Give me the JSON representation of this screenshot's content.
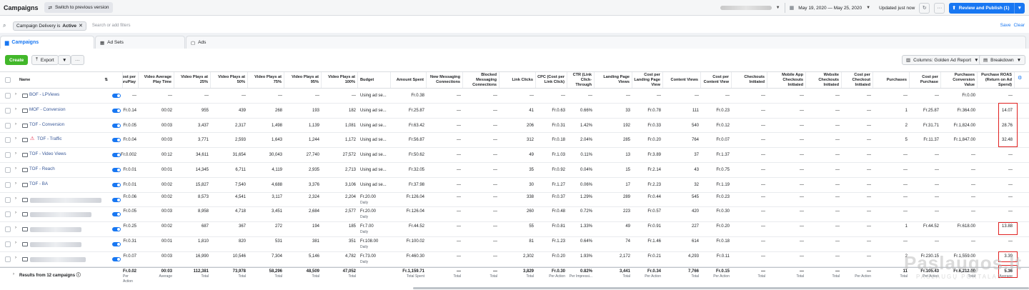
{
  "topbar": {
    "title": "Campaigns",
    "switch_label": "Switch to previous version",
    "date_range": "May 19, 2020 — May 25, 2020",
    "updated": "Updated just now",
    "publish_label": "Review and Publish (1)",
    "more": "···"
  },
  "filter": {
    "chip_prefix": "Campaign Delivery is ",
    "chip_value": "Active",
    "placeholder": "Search or add filters",
    "save": "Save",
    "clear": "Clear"
  },
  "tabs": {
    "campaigns": "Campaigns",
    "ad_sets": "Ad Sets",
    "ads": "Ads"
  },
  "toolbar": {
    "create": "Create",
    "export": "Export",
    "more": "···",
    "columns": "Columns: Golden Ad Report",
    "breakdown": "Breakdown"
  },
  "headers": {
    "name": "Name",
    "c1": "Cost per ThruPlay",
    "c2": "Video Average Play Time",
    "c3": "Video Plays at 25%",
    "c4": "Video Plays at 50%",
    "c5": "Video Plays at 75%",
    "c6": "Video Plays at 95%",
    "c7": "Video Plays at 100%",
    "c8": "Budget",
    "c9": "Amount Spent",
    "c10": "New Messaging Connections",
    "c11": "Blocked Messaging Connections",
    "c12": "Link Clicks",
    "c13": "CPC (Cost per Link Click)",
    "c14": "CTR (Link Click-Through",
    "c15": "Landing Page Views",
    "c16": "Cost per Landing Page View",
    "c17": "Content Views",
    "c18": "Cost per Content View",
    "c19": "Checkouts Initiated",
    "c20": "Mobile App Checkouts Initiated",
    "c21": "Website Checkouts Initiated",
    "c22": "Cost per Checkout Initiated",
    "c23": "Purchases",
    "c24": "Cost per Purchase",
    "c25": "Purchases Conversion Value",
    "c26": "Purchase ROAS (Return on Ad Spend)"
  },
  "rows": [
    {
      "name": "BOF - LPViews",
      "warn": false,
      "tall": false,
      "cells": [
        "—",
        "—",
        "—",
        "—",
        "—",
        "—",
        "—",
        "Using ad se...",
        "Fr.0.38",
        "—",
        "—",
        "—",
        "—",
        "—",
        "—",
        "—",
        "—",
        "—",
        "—",
        "—",
        "—",
        "—",
        "—",
        "—",
        "Fr.0.00",
        "—"
      ]
    },
    {
      "name": "MOF - Conversion",
      "warn": false,
      "tall": false,
      "cells": [
        "Fr.0.14",
        "00:02",
        "955",
        "439",
        "268",
        "193",
        "182",
        "Using ad se...",
        "Fr.25.87",
        "—",
        "—",
        "41",
        "Fr.0.63",
        "0.66%",
        "33",
        "Fr.0.78",
        "111",
        "Fr.0.23",
        "—",
        "—",
        "—",
        "—",
        "1",
        "Fr.25.87",
        "Fr.364.00",
        "14.07"
      ]
    },
    {
      "name": "TOF - Conversion",
      "warn": false,
      "tall": false,
      "cells": [
        "Fr.0.05",
        "00:03",
        "3,437",
        "2,317",
        "1,498",
        "1,139",
        "1,081",
        "Using ad se...",
        "Fr.63.42",
        "—",
        "—",
        "206",
        "Fr.0.31",
        "1.42%",
        "192",
        "Fr.0.33",
        "540",
        "Fr.0.12",
        "—",
        "—",
        "—",
        "—",
        "2",
        "Fr.31.71",
        "Fr.1,824.00",
        "28.76"
      ]
    },
    {
      "name": "TOF - Traffic",
      "warn": true,
      "tall": false,
      "cells": [
        "Fr.0.04",
        "00:03",
        "3,771",
        "2,593",
        "1,643",
        "1,244",
        "1,172",
        "Using ad se...",
        "Fr.56.87",
        "—",
        "—",
        "312",
        "Fr.0.18",
        "2.04%",
        "285",
        "Fr.0.20",
        "764",
        "Fr.0.07",
        "—",
        "—",
        "—",
        "—",
        "5",
        "Fr.11.37",
        "Fr.1,847.00",
        "32.48"
      ]
    },
    {
      "name": "TOF - Video Views",
      "warn": false,
      "tall": false,
      "cells": [
        "Fr.0.002",
        "00:12",
        "34,611",
        "31,654",
        "30,043",
        "27,740",
        "27,572",
        "Using ad se...",
        "Fr.50.62",
        "—",
        "—",
        "49",
        "Fr.1.03",
        "0.11%",
        "13",
        "Fr.3.89",
        "37",
        "Fr.1.37",
        "—",
        "—",
        "—",
        "—",
        "—",
        "—",
        "—",
        "—"
      ]
    },
    {
      "name": "TOF - Reach",
      "warn": false,
      "tall": false,
      "cells": [
        "Fr.0.01",
        "00:01",
        "14,345",
        "6,711",
        "4,119",
        "2,935",
        "2,713",
        "Using ad se...",
        "Fr.32.05",
        "—",
        "—",
        "35",
        "Fr.0.92",
        "0.04%",
        "15",
        "Fr.2.14",
        "43",
        "Fr.0.75",
        "—",
        "—",
        "—",
        "—",
        "—",
        "—",
        "—",
        "—"
      ]
    },
    {
      "name": "TOF - BA",
      "warn": false,
      "tall": false,
      "cells": [
        "Fr.0.01",
        "00:02",
        "15,827",
        "7,540",
        "4,688",
        "3,376",
        "3,106",
        "Using ad se...",
        "Fr.37.98",
        "—",
        "—",
        "30",
        "Fr.1.27",
        "0.06%",
        "17",
        "Fr.2.23",
        "32",
        "Fr.1.19",
        "—",
        "—",
        "—",
        "—",
        "—",
        "—",
        "—",
        "—"
      ]
    },
    {
      "name": "",
      "warn": false,
      "tall": true,
      "cells": [
        "Fr.0.06",
        "00:02",
        "8,573",
        "4,541",
        "3,117",
        "2,324",
        "2,204",
        "Fr.20.00",
        "Fr.126.04",
        "—",
        "—",
        "338",
        "Fr.0.37",
        "1.29%",
        "289",
        "Fr.0.44",
        "545",
        "Fr.0.23",
        "—",
        "—",
        "—",
        "—",
        "—",
        "—",
        "—",
        "—"
      ],
      "budget_sub": "Daily"
    },
    {
      "name": "",
      "warn": false,
      "tall": true,
      "cells": [
        "Fr.0.05",
        "00:03",
        "8,958",
        "4,718",
        "3,451",
        "2,684",
        "2,577",
        "Fr.20.00",
        "Fr.126.04",
        "—",
        "—",
        "260",
        "Fr.0.48",
        "0.72%",
        "223",
        "Fr.0.57",
        "420",
        "Fr.0.30",
        "—",
        "—",
        "—",
        "—",
        "—",
        "—",
        "—",
        "—"
      ],
      "budget_sub": "Daily"
    },
    {
      "name": "",
      "warn": false,
      "tall": true,
      "cells": [
        "Fr.0.25",
        "00:02",
        "687",
        "367",
        "272",
        "194",
        "185",
        "Fr.7.00",
        "Fr.44.52",
        "—",
        "—",
        "55",
        "Fr.0.81",
        "1.33%",
        "49",
        "Fr.0.91",
        "227",
        "Fr.0.20",
        "—",
        "—",
        "—",
        "—",
        "1",
        "Fr.44.52",
        "Fr.618.00",
        "13.88"
      ],
      "budget_sub": "Daily"
    },
    {
      "name": "",
      "warn": false,
      "tall": true,
      "cells": [
        "Fr.0.31",
        "00:01",
        "1,810",
        "820",
        "531",
        "381",
        "351",
        "Fr.108.00",
        "Fr.100.02",
        "—",
        "—",
        "81",
        "Fr.1.23",
        "0.64%",
        "74",
        "Fr.1.46",
        "614",
        "Fr.0.18",
        "—",
        "—",
        "—",
        "—",
        "—",
        "—",
        "—",
        "—"
      ],
      "budget_sub": "Daily"
    },
    {
      "name": "",
      "warn": false,
      "tall": true,
      "cells": [
        "Fr.0.07",
        "00:03",
        "16,990",
        "10,546",
        "7,304",
        "5,146",
        "4,782",
        "Fr.73.00",
        "Fr.460.30",
        "—",
        "—",
        "2,302",
        "Fr.0.20",
        "1.93%",
        "2,172",
        "Fr.0.21",
        "4,293",
        "Fr.0.11",
        "—",
        "—",
        "—",
        "—",
        "2",
        "Fr.230.15",
        "Fr.1,559.00",
        "3.39"
      ],
      "budget_sub": "Daily"
    }
  ],
  "totals": {
    "label": "Results from 12 campaigns",
    "values": [
      "Fr.0.02",
      "00:03",
      "112,381",
      "73,978",
      "58,296",
      "48,509",
      "47,052",
      "",
      "Fr.1,159.71",
      "—",
      "—",
      "3,829",
      "Fr.0.30",
      "0.82%",
      "3,441",
      "Fr.0.34",
      "7,766",
      "Fr.0.15",
      "—",
      "—",
      "—",
      "—",
      "11",
      "Fr.105.43",
      "Fr.6,212.00",
      "5.36"
    ],
    "sublabels": [
      "Per Action",
      "Average",
      "Total",
      "Total",
      "Total",
      "Total",
      "Total",
      "",
      "Total Spent",
      "Total",
      "Total",
      "Total",
      "Per Action",
      "Per Impressi...",
      "Total",
      "Per Action",
      "Total",
      "Per Action",
      "Total",
      "Total",
      "Total",
      "Per Action",
      "Total",
      "Per Action",
      "Total",
      "Average"
    ]
  },
  "watermark": {
    "main": "Paslaugos.lt",
    "sub": "PASLAUGŲ PORTALAS"
  }
}
